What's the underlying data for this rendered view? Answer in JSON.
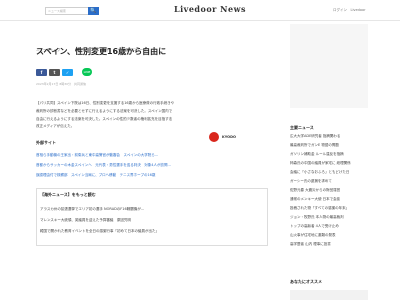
{
  "header": {
    "search_placeholder": "ニュース検索",
    "search_icon_label": "🔍",
    "logo": "Livedoor News",
    "login": "ログイン　Livedoor"
  },
  "nav": [
    "ニューストップ",
    "国内",
    "海外",
    "国内ニュース"
  ],
  "article": {
    "title": "スペイン、性別変更16歳から自由に",
    "share_facebook": "f",
    "share_twitter": "t",
    "share_line": "LINE",
    "date": "2023年2月17日 8時30分　共同通信",
    "body": [
      "【パリ共同】スペイン下院は16日、性別変更を支援する16歳から医療費の行政手続きや",
      "裁判所の診断書などを必要とせずに行えるようにする法案を可決した。スペイン国内で",
      "自由に行えるようにする法案を可決した。スペインの性的少数者の権利拡充を目指す法",
      "改正メディアが伝えた。"
    ],
    "source_logo_text": "KYODO"
  },
  "external": {
    "heading": "外部サイト",
    "links": [
      "首相ら手動機の王家出・前衛兵と東中高警官が動審会　スペインの大学院ら…",
      "首都からサッカーの木金スペインへ　元代表・男性選手を巡る判決　対象4人が訪問…",
      "誤認理由付で検察部　スペイン当局に、プロへ移動　テニス界ホープの16歳"
    ]
  },
  "related": {
    "heading": "【海外ニュース】をもっと読む",
    "items": [
      "アラスカ州の拡張選挙でエリア初の選手 NORADのF16戦闘機が…",
      "マレンスキー大統領、英議員を迎えた予算審議　原因究明",
      "韓国で開かれた教育イベントを全日の感謝行事「初めて日本の議員が出た」"
    ]
  },
  "sidebar": {
    "heading": "主要ニュース",
    "items": [
      "広大大学ADE研究者 指摘関わる",
      "最高裁判所でガンE 物語の問題",
      "ガソリン補助金 ルール違反を指摘",
      "柿森氏の中国の議員が家宅に 総理関係",
      "会議に「小さなおふろ」ともどけた日",
      "ガーシー氏の逮捕を求めて",
      "佐野元春 大震災からの財団運営",
      "通常のメンキー大使 日本で会談",
      "投稿された物「すべての感謝の年末」",
      "ジョン・牧野氏 本人物の最高裁判",
      "トップの高齢者 4人で受け止め",
      "山火事が住宅地に避難の発表",
      "高学歴者 山内 理事に投書"
    ],
    "recommend_heading": "あなたにオススメ"
  }
}
